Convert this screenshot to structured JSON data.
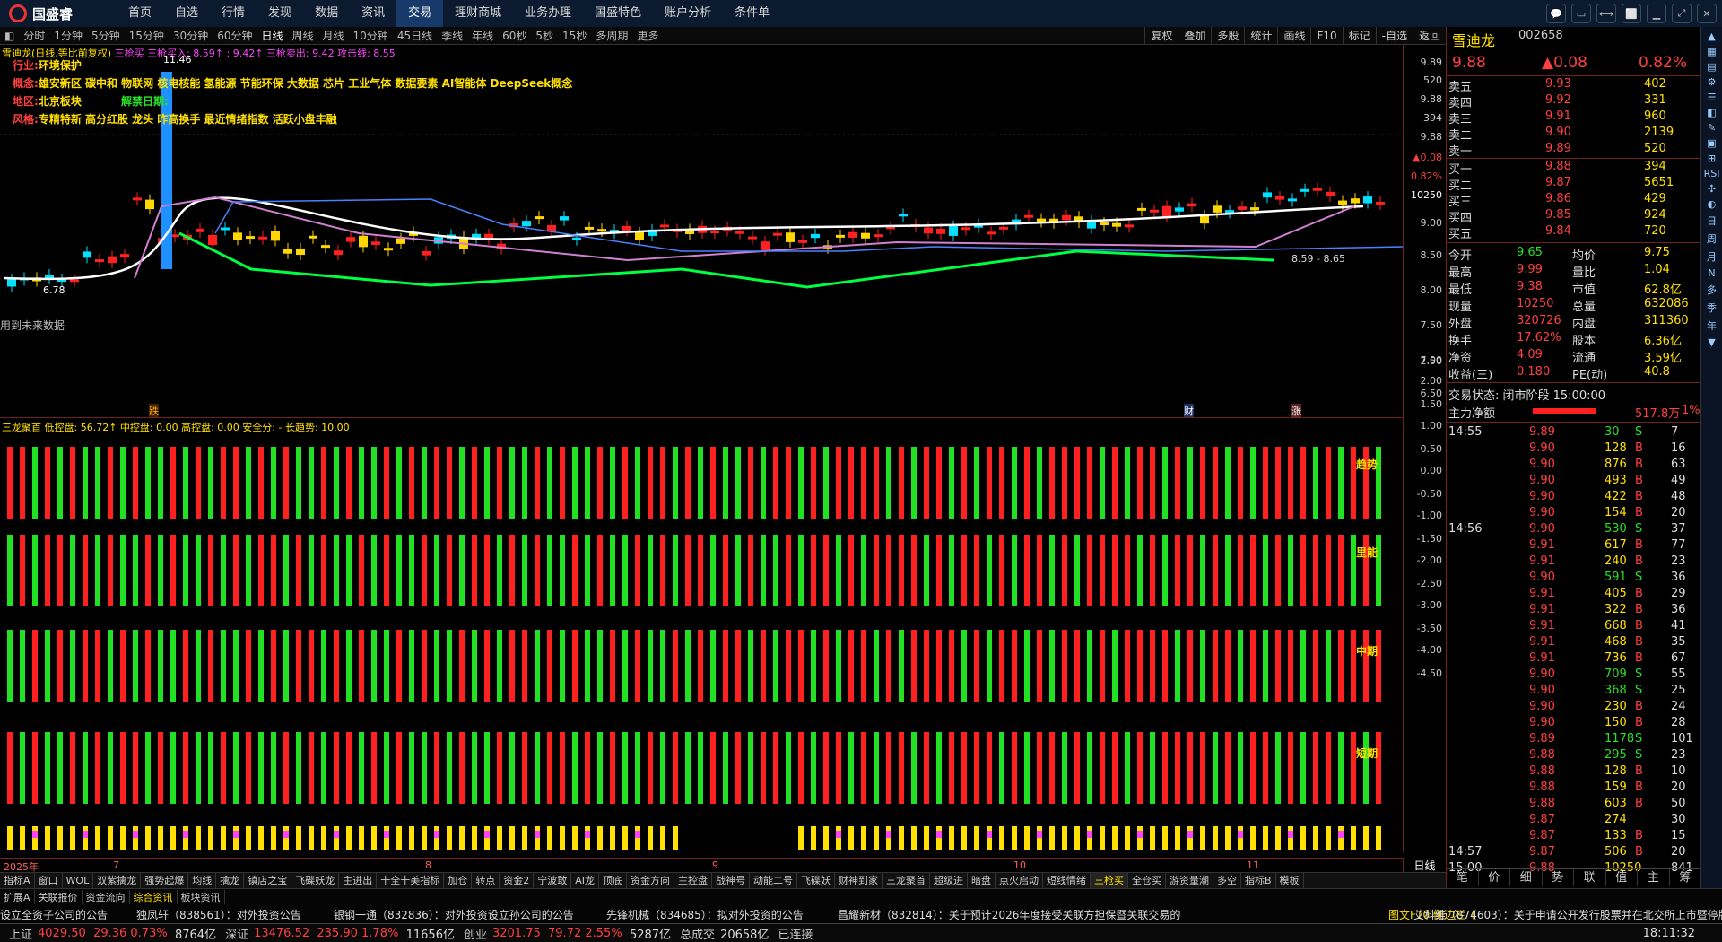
{
  "app": {
    "logo": "国盛睿",
    "menu": [
      "首页",
      "自选",
      "行情",
      "发现",
      "数据",
      "资讯",
      "交易",
      "理财商城",
      "业务办理",
      "国盛特色",
      "账户分析",
      "条件单"
    ],
    "active_menu": "交易",
    "winbtns": [
      "💬",
      "▭",
      "⟷",
      "⬜",
      "▁",
      "⤢",
      "✕"
    ]
  },
  "periods": [
    "分时",
    "1分钟",
    "5分钟",
    "15分钟",
    "30分钟",
    "60分钟",
    "日线",
    "周线",
    "月线",
    "10分钟",
    "45日线",
    "季线",
    "年线",
    "60秒",
    "5秒",
    "15秒",
    "多周期",
    "更多"
  ],
  "active_period": "日线",
  "tools": [
    "复权",
    "叠加",
    "多股",
    "统计",
    "画线",
    "F10",
    "标记",
    "-自选",
    "返回"
  ],
  "chart_title": {
    "name": "雪迪龙(日线,等比前复权)",
    "ind": "三枪买 三枪买入: 8.59↑ : 9.42↑ 三枪卖出: 9.42 攻击线: 8.55"
  },
  "info": {
    "industry_l": "行业:",
    "industry": "环境保护",
    "concept_l": "概念:",
    "concept": "雄安新区 碳中和 物联网 核电核能 氢能源 节能环保 大数据 芯片 工业气体 数据要素 AI智能体 DeepSeek概念",
    "region_l": "地区:",
    "region": "北京板块",
    "unlock_l": "解禁日期:",
    "style_l": "风格:",
    "style": "专精特新 高分红股 龙头 昨高换手 最近情绪指数 活跃小盘丰融"
  },
  "chart_notes": {
    "high": "11.46",
    "low": "6.78",
    "future": "用到未来数据",
    "label1": "跌",
    "label2": "财",
    "label3": "涨",
    "zone": "8.59 - 8.65"
  },
  "yaxis_main": [
    "9.89",
    "520",
    "9.88",
    "394",
    "9.88",
    "▲0.08",
    "0.82%",
    "10250",
    "9.00",
    "8.50",
    "8.00",
    "7.50",
    "7.00",
    "6.50"
  ],
  "ind_title": "三龙聚首 低控盘: 56.72↑ 中控盘: 0.00 高控盘: 0.00 安全分: - 长趋势: 10.00",
  "ind_labels": [
    "趋势",
    "里能",
    "中期",
    "短期"
  ],
  "yaxis_ind": [
    "2.50",
    "2.00",
    "1.50",
    "1.00",
    "0.50",
    "0.00",
    "-0.50",
    "-1.00",
    "-1.50",
    "-2.00",
    "-2.50",
    "-3.00",
    "-3.50",
    "-4.00",
    "-4.50"
  ],
  "dates": [
    "2025年",
    "7",
    "8",
    "9",
    "10",
    "11"
  ],
  "bottom_tabs": [
    "指标A",
    "窗口",
    "WOL",
    "双紫擒龙",
    "强势起爆",
    "均线",
    "擒龙",
    "镇店之宝",
    "飞碟妖龙",
    "主进出",
    "十全十美指标",
    "加仓",
    "转点",
    "资金2",
    "宁波敢",
    "AI龙",
    "顶底",
    "资金方向",
    "主控盘",
    "战神号",
    "动能二号",
    "飞碟妖",
    "财神到家",
    "三龙聚首",
    "超级进",
    "暗盘",
    "点火启动",
    "短线情绪",
    "三枪买",
    "全仓买",
    "游资量潮",
    "多空",
    "指标B",
    "模板"
  ],
  "bottom_tabs2": [
    "扩展A",
    "关联报价",
    "资金流向",
    "综合资讯",
    "板块资讯"
  ],
  "news": [
    "设立全资子公司的公告",
    "独凤轩（838561）：对外投资公告",
    "银钢一通（832836）：对外投资设立孙公司的公告",
    "先锋机械（834685）：拟对外投资的公告",
    "昌耀新材（832814）：关于预计2026年度接受关联方担保暨关联交易的",
    "图文F10 侧边栏《",
    "艾科维（874603）：关于申请公开发行股票并在北交所上市暨停牌"
  ],
  "status": {
    "sh_l": "上证",
    "sh": "4029.50",
    "sh_c": "29.36",
    "sh_p": "0.73%",
    "sh_v": "8764亿",
    "sz_l": "深证",
    "sz": "13476.52",
    "sz_c": "235.90",
    "sz_p": "1.78%",
    "sz_v": "11656亿",
    "cy_l": "创业",
    "cy": "3201.75",
    "cy_c": "79.72",
    "cy_p": "2.55%",
    "cy_v": "5287亿",
    "tot_l": "总成交",
    "tot": "20658亿",
    "conn": "已连接",
    "time": "18:11:32"
  },
  "quote": {
    "name": "雪迪龙",
    "code": "002658",
    "price": "9.88",
    "chg": "▲0.08",
    "pct": "0.82%",
    "asks": [
      [
        "卖五",
        "9.93",
        "402"
      ],
      [
        "卖四",
        "9.92",
        "331"
      ],
      [
        "卖三",
        "9.91",
        "960"
      ],
      [
        "卖二",
        "9.90",
        "2139"
      ],
      [
        "卖一",
        "9.89",
        "520"
      ]
    ],
    "bids": [
      [
        "买一",
        "9.88",
        "394"
      ],
      [
        "买二",
        "9.87",
        "5651"
      ],
      [
        "买三",
        "9.86",
        "429"
      ],
      [
        "买四",
        "9.85",
        "924"
      ],
      [
        "买五",
        "9.84",
        "720"
      ]
    ],
    "stats": [
      [
        "今开",
        "9.65",
        "均价",
        "9.75"
      ],
      [
        "最高",
        "9.99",
        "量比",
        "1.04"
      ],
      [
        "最低",
        "9.38",
        "市值",
        "62.8亿"
      ],
      [
        "现量",
        "10250",
        "总量",
        "632086"
      ],
      [
        "外盘",
        "320726",
        "内盘",
        "311360"
      ],
      [
        "换手",
        "17.62%",
        "股本",
        "6.36亿"
      ],
      [
        "净资",
        "4.09",
        "流通",
        "3.59亿"
      ],
      [
        "收益(三)",
        "0.180",
        "PE(动)",
        "40.8"
      ]
    ],
    "state": "交易状态: 闭市阶段 15:00:00",
    "flow_l": "主力净额",
    "flow": "517.8万",
    "flow_p": "1%"
  },
  "ticks": [
    [
      "14:55",
      "9.89",
      "30",
      "S",
      "7"
    ],
    [
      "",
      "9.90",
      "128",
      "B",
      "16"
    ],
    [
      "",
      "9.90",
      "876",
      "B",
      "63"
    ],
    [
      "",
      "9.90",
      "493",
      "B",
      "49"
    ],
    [
      "",
      "9.90",
      "422",
      "B",
      "48"
    ],
    [
      "",
      "9.90",
      "154",
      "B",
      "20"
    ],
    [
      "14:56",
      "9.90",
      "530",
      "S",
      "37"
    ],
    [
      "",
      "9.91",
      "617",
      "B",
      "77"
    ],
    [
      "",
      "9.91",
      "240",
      "B",
      "23"
    ],
    [
      "",
      "9.90",
      "591",
      "S",
      "36"
    ],
    [
      "",
      "9.91",
      "405",
      "B",
      "29"
    ],
    [
      "",
      "9.91",
      "322",
      "B",
      "36"
    ],
    [
      "",
      "9.91",
      "668",
      "B",
      "41"
    ],
    [
      "",
      "9.91",
      "468",
      "B",
      "35"
    ],
    [
      "",
      "9.91",
      "736",
      "B",
      "67"
    ],
    [
      "",
      "9.90",
      "709",
      "S",
      "55"
    ],
    [
      "",
      "9.90",
      "368",
      "S",
      "25"
    ],
    [
      "",
      "9.90",
      "230",
      "B",
      "24"
    ],
    [
      "",
      "9.90",
      "150",
      "B",
      "28"
    ],
    [
      "",
      "9.89",
      "1178",
      "S",
      "101"
    ],
    [
      "",
      "9.88",
      "295",
      "S",
      "23"
    ],
    [
      "",
      "9.88",
      "128",
      "B",
      "10"
    ],
    [
      "",
      "9.88",
      "159",
      "B",
      "20"
    ],
    [
      "",
      "9.88",
      "603",
      "B",
      "50"
    ],
    [
      "",
      "9.87",
      "274",
      "",
      "30"
    ],
    [
      "",
      "9.87",
      "133",
      "B",
      "15"
    ],
    [
      "14:57",
      "9.87",
      "506",
      "B",
      "20"
    ],
    [
      "15:00",
      "9.88",
      "10250",
      "",
      "841"
    ]
  ],
  "rp_tabs": [
    "笔",
    "价",
    "细",
    "势",
    "联",
    "值",
    "主",
    "筹"
  ],
  "side_icons": [
    "▲",
    "▦",
    "▤",
    "⚙",
    "☰",
    "◧",
    "✎",
    "▣",
    "⊞",
    "RSI",
    "✣",
    "◐",
    "日",
    "周",
    "月",
    "N",
    "多",
    "季",
    "年",
    "▼"
  ]
}
